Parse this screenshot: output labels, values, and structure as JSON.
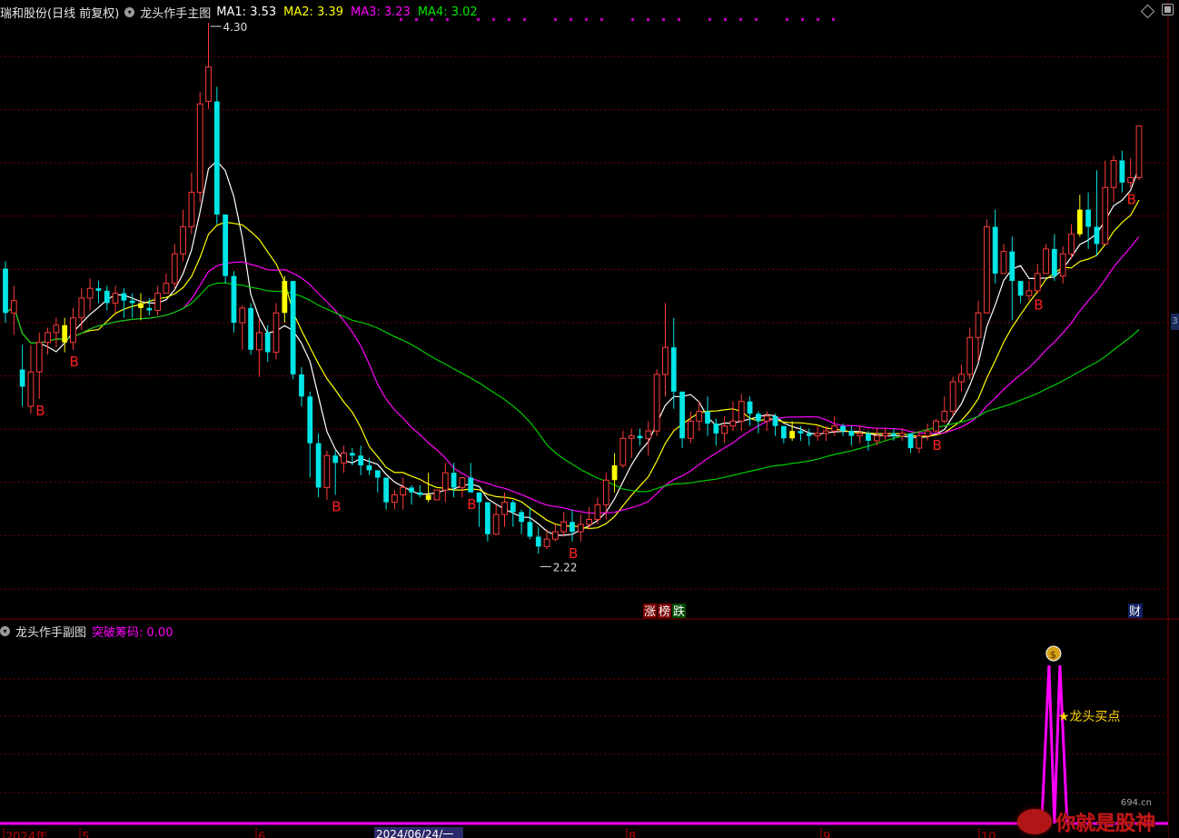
{
  "header": {
    "stock_title": "瑞和股份(日线 前复权)",
    "main_indicator": "龙头作手主图",
    "ma_items": [
      {
        "label": "MA1: 3.53",
        "color": "#ffffff"
      },
      {
        "label": "MA2: 3.39",
        "color": "#ffff00"
      },
      {
        "label": "MA3: 3.23",
        "color": "#ff00ff"
      },
      {
        "label": "MA4: 3.02",
        "color": "#00e600"
      }
    ]
  },
  "sub_header": {
    "title": "龙头作手副图",
    "value_label": "突破筹码: 0.00",
    "value_color": "#ff00ff"
  },
  "right_tab": "3",
  "watermark": {
    "text": "你就是股神",
    "url": "694.cn"
  },
  "chart_data": {
    "type": "candlestick",
    "price_range": [
      2.07,
      4.38
    ],
    "candles": [
      [
        3.38,
        3.2,
        3.41,
        3.16
      ],
      [
        3.2,
        3.25,
        3.31,
        3.11
      ],
      [
        2.97,
        2.9,
        3.07,
        2.82
      ],
      [
        2.82,
        2.96,
        3.07,
        2.79
      ],
      [
        2.96,
        3.08,
        3.12,
        2.85
      ],
      [
        3.08,
        3.12,
        3.14,
        3.03
      ],
      [
        3.12,
        3.15,
        3.18,
        3.06
      ],
      [
        3.15,
        3.08,
        3.18,
        3.04
      ],
      [
        3.08,
        3.18,
        3.22,
        3.05
      ],
      [
        3.18,
        3.26,
        3.3,
        3.13
      ],
      [
        3.26,
        3.3,
        3.34,
        3.21
      ],
      [
        3.3,
        3.29,
        3.33,
        3.24
      ],
      [
        3.29,
        3.24,
        3.31,
        3.21
      ],
      [
        3.24,
        3.28,
        3.31,
        3.2
      ],
      [
        3.28,
        3.25,
        3.3,
        3.18
      ],
      [
        3.25,
        3.24,
        3.28,
        3.18
      ],
      [
        3.24,
        3.22,
        3.28,
        3.17
      ],
      [
        3.22,
        3.21,
        3.26,
        3.19
      ],
      [
        3.21,
        3.28,
        3.31,
        3.19
      ],
      [
        3.28,
        3.32,
        3.36,
        3.28
      ],
      [
        3.32,
        3.44,
        3.48,
        3.3
      ],
      [
        3.44,
        3.55,
        3.62,
        3.41
      ],
      [
        3.55,
        3.69,
        3.77,
        3.52
      ],
      [
        3.69,
        4.05,
        4.1,
        3.65
      ],
      [
        4.06,
        4.2,
        4.38,
        4.03
      ],
      [
        4.06,
        3.6,
        4.12,
        3.56
      ],
      [
        3.6,
        3.35,
        3.6,
        3.32
      ],
      [
        3.35,
        3.16,
        3.37,
        3.12
      ],
      [
        3.16,
        3.22,
        3.23,
        3.05
      ],
      [
        3.22,
        3.05,
        3.24,
        3.03
      ],
      [
        3.05,
        3.12,
        3.18,
        2.94
      ],
      [
        3.12,
        3.04,
        3.15,
        3.0
      ],
      [
        3.04,
        3.2,
        3.24,
        3.01
      ],
      [
        3.2,
        3.33,
        3.35,
        3.16
      ],
      [
        3.33,
        2.95,
        3.33,
        2.93
      ],
      [
        2.95,
        2.86,
        2.98,
        2.82
      ],
      [
        2.86,
        2.67,
        2.88,
        2.53
      ],
      [
        2.67,
        2.49,
        2.71,
        2.45
      ],
      [
        2.49,
        2.62,
        2.64,
        2.44
      ],
      [
        2.62,
        2.59,
        2.64,
        2.46
      ],
      [
        2.59,
        2.63,
        2.66,
        2.55
      ],
      [
        2.63,
        2.62,
        2.65,
        2.58
      ],
      [
        2.62,
        2.58,
        2.66,
        2.54
      ],
      [
        2.58,
        2.56,
        2.61,
        2.54
      ],
      [
        2.56,
        2.53,
        2.56,
        2.47
      ],
      [
        2.53,
        2.43,
        2.53,
        2.4
      ],
      [
        2.43,
        2.46,
        2.48,
        2.4
      ],
      [
        2.46,
        2.49,
        2.53,
        2.4
      ],
      [
        2.49,
        2.47,
        2.5,
        2.42
      ],
      [
        2.47,
        2.46,
        2.5,
        2.45
      ],
      [
        2.46,
        2.44,
        2.55,
        2.43
      ],
      [
        2.44,
        2.48,
        2.48,
        2.44
      ],
      [
        2.48,
        2.55,
        2.59,
        2.43
      ],
      [
        2.55,
        2.49,
        2.59,
        2.45
      ],
      [
        2.49,
        2.53,
        2.53,
        2.45
      ],
      [
        2.53,
        2.47,
        2.59,
        2.47
      ],
      [
        2.47,
        2.43,
        2.47,
        2.33
      ],
      [
        2.43,
        2.3,
        2.43,
        2.27
      ],
      [
        2.3,
        2.38,
        2.42,
        2.3
      ],
      [
        2.38,
        2.43,
        2.47,
        2.33
      ],
      [
        2.43,
        2.39,
        2.44,
        2.33
      ],
      [
        2.39,
        2.35,
        2.4,
        2.3
      ],
      [
        2.35,
        2.29,
        2.41,
        2.28
      ],
      [
        2.29,
        2.25,
        2.33,
        2.22
      ],
      [
        2.25,
        2.28,
        2.32,
        2.24
      ],
      [
        2.28,
        2.31,
        2.34,
        2.27
      ],
      [
        2.31,
        2.35,
        2.39,
        2.29
      ],
      [
        2.35,
        2.31,
        2.4,
        2.27
      ],
      [
        2.31,
        2.34,
        2.38,
        2.27
      ],
      [
        2.34,
        2.36,
        2.41,
        2.32
      ],
      [
        2.36,
        2.42,
        2.45,
        2.34
      ],
      [
        2.42,
        2.52,
        2.55,
        2.36
      ],
      [
        2.52,
        2.58,
        2.63,
        2.47
      ],
      [
        2.58,
        2.69,
        2.72,
        2.57
      ],
      [
        2.69,
        2.7,
        2.73,
        2.61
      ],
      [
        2.7,
        2.69,
        2.73,
        2.66
      ],
      [
        2.69,
        2.72,
        2.76,
        2.62
      ],
      [
        2.72,
        2.95,
        2.97,
        2.7
      ],
      [
        2.95,
        3.06,
        3.24,
        2.86
      ],
      [
        3.06,
        2.88,
        3.18,
        2.81
      ],
      [
        2.88,
        2.69,
        2.88,
        2.65
      ],
      [
        2.69,
        2.76,
        2.8,
        2.67
      ],
      [
        2.76,
        2.8,
        2.84,
        2.72
      ],
      [
        2.8,
        2.75,
        2.86,
        2.7
      ],
      [
        2.75,
        2.71,
        2.77,
        2.66
      ],
      [
        2.71,
        2.74,
        2.78,
        2.67
      ],
      [
        2.74,
        2.76,
        2.84,
        2.72
      ],
      [
        2.76,
        2.84,
        2.87,
        2.72
      ],
      [
        2.84,
        2.79,
        2.86,
        2.74
      ],
      [
        2.79,
        2.76,
        2.8,
        2.71
      ],
      [
        2.76,
        2.78,
        2.8,
        2.72
      ],
      [
        2.78,
        2.74,
        2.79,
        2.7
      ],
      [
        2.74,
        2.69,
        2.74,
        2.67
      ],
      [
        2.69,
        2.72,
        2.76,
        2.68
      ],
      [
        2.72,
        2.71,
        2.74,
        2.68
      ],
      [
        2.71,
        2.7,
        2.73,
        2.66
      ],
      [
        2.7,
        2.71,
        2.74,
        2.68
      ],
      [
        2.71,
        2.72,
        2.74,
        2.68
      ],
      [
        2.72,
        2.74,
        2.78,
        2.7
      ],
      [
        2.74,
        2.72,
        2.75,
        2.7
      ],
      [
        2.72,
        2.7,
        2.74,
        2.66
      ],
      [
        2.7,
        2.71,
        2.74,
        2.67
      ],
      [
        2.71,
        2.68,
        2.72,
        2.64
      ],
      [
        2.68,
        2.7,
        2.73,
        2.66
      ],
      [
        2.7,
        2.71,
        2.73,
        2.68
      ],
      [
        2.71,
        2.7,
        2.73,
        2.68
      ],
      [
        2.7,
        2.71,
        2.73,
        2.68
      ],
      [
        2.71,
        2.65,
        2.71,
        2.63
      ],
      [
        2.65,
        2.7,
        2.72,
        2.63
      ],
      [
        2.7,
        2.72,
        2.75,
        2.68
      ],
      [
        2.72,
        2.76,
        2.77,
        2.71
      ],
      [
        2.76,
        2.8,
        2.86,
        2.75
      ],
      [
        2.8,
        2.92,
        2.94,
        2.78
      ],
      [
        2.92,
        2.95,
        2.99,
        2.88
      ],
      [
        2.95,
        3.1,
        3.14,
        2.93
      ],
      [
        3.1,
        3.2,
        3.25,
        3.0
      ],
      [
        3.2,
        3.55,
        3.58,
        3.2
      ],
      [
        3.55,
        3.36,
        3.62,
        3.32
      ],
      [
        3.36,
        3.45,
        3.48,
        3.36
      ],
      [
        3.45,
        3.33,
        3.51,
        3.17
      ],
      [
        3.33,
        3.27,
        3.31,
        3.24
      ],
      [
        3.27,
        3.29,
        3.33,
        3.25
      ],
      [
        3.29,
        3.36,
        3.4,
        3.28
      ],
      [
        3.36,
        3.46,
        3.48,
        3.36
      ],
      [
        3.46,
        3.35,
        3.52,
        3.33
      ],
      [
        3.35,
        3.44,
        3.47,
        3.32
      ],
      [
        3.44,
        3.52,
        3.56,
        3.42
      ],
      [
        3.52,
        3.62,
        3.68,
        3.51
      ],
      [
        3.62,
        3.55,
        3.69,
        3.46
      ],
      [
        3.55,
        3.48,
        3.78,
        3.43
      ],
      [
        3.48,
        3.71,
        3.82,
        3.5
      ],
      [
        3.71,
        3.82,
        3.84,
        3.65
      ],
      [
        3.82,
        3.73,
        3.86,
        3.69
      ],
      [
        3.73,
        3.75,
        3.83,
        3.71
      ],
      [
        3.75,
        3.96,
        3.96,
        3.74
      ]
    ],
    "annotations": {
      "high": "4.30",
      "low": "2.22"
    },
    "signal_marks": {
      "buy_label": "B",
      "limit_tags": [
        "涨",
        "榜",
        "跌"
      ],
      "fin_tag": "财"
    },
    "sub_chart": {
      "signal_label": "★龙头买点"
    },
    "x_axis": {
      "date_label": "2024/06/24/一",
      "partial_labels": [
        "2024年",
        "5",
        "6",
        "8",
        "9",
        "10"
      ]
    },
    "colors": {
      "up": "#ff3b3b",
      "down": "#00e5e5",
      "limit_up": "#ffff00",
      "grid": "#7a0000",
      "signal": "#ff00ff"
    }
  }
}
